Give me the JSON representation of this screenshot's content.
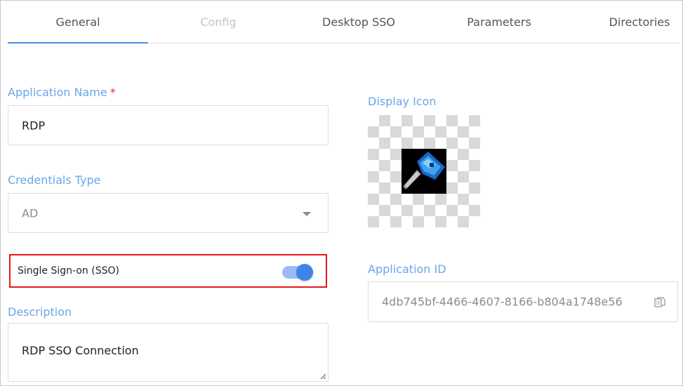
{
  "tabs": [
    {
      "label": "General",
      "state": "active"
    },
    {
      "label": "Config",
      "state": "disabled"
    },
    {
      "label": "Desktop SSO",
      "state": "normal"
    },
    {
      "label": "Parameters",
      "state": "normal"
    },
    {
      "label": "Directories",
      "state": "normal"
    }
  ],
  "form": {
    "app_name_label": "Application Name",
    "required_mark": "*",
    "app_name_value": "RDP",
    "cred_type_label": "Credentials Type",
    "cred_type_value": "AD",
    "sso_label": "Single Sign-on (SSO)",
    "sso_enabled": true,
    "description_label": "Description",
    "description_value": "RDP SSO Connection",
    "display_icon_label": "Display Icon",
    "display_icon_name": "key-icon",
    "app_id_label": "Application ID",
    "app_id_value": "4db745bf-4466-4607-8166-b804a1748e56",
    "copy_icon_name": "copy-icon"
  },
  "colors": {
    "label": "#6aa6e8",
    "tab_active_underline": "#4a90e2",
    "required": "#e0322f",
    "highlight_border": "#e0191b",
    "toggle_on": "#3d84ea"
  }
}
